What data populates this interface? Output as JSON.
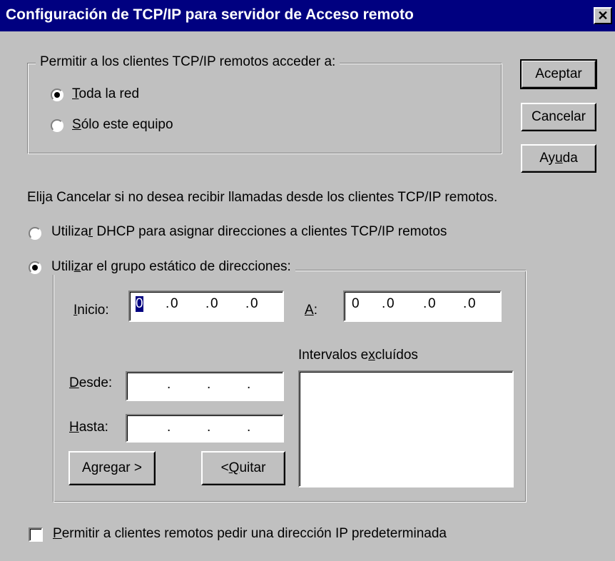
{
  "window": {
    "title": "Configuración de TCP/IP para servidor de Acceso remoto",
    "close_glyph": "✕"
  },
  "access_group": {
    "legend": "Permitir a los clientes TCP/IP remotos acceder a:",
    "options": [
      {
        "label_u": "T",
        "label_rest": "oda la red",
        "selected": true
      },
      {
        "label_u": "S",
        "label_rest": "ólo este equipo",
        "selected": false
      }
    ]
  },
  "buttons": {
    "accept": "Aceptar",
    "cancel": "Cancelar",
    "help_pre": "Ay",
    "help_u": "u",
    "help_post": "da"
  },
  "info_text": "Elija Cancelar si no desea recibir llamadas desde los clientes TCP/IP remotos.",
  "assignment": {
    "dhcp_pre": "Utiliza",
    "dhcp_u": "r",
    "dhcp_post": " DHCP para asignar direcciones a clientes TCP/IP remotos",
    "dhcp_selected": false,
    "static_pre": "Utili",
    "static_u": "z",
    "static_post": "ar el grupo estático de direcciones:",
    "static_selected": true
  },
  "static_pool": {
    "start_u": "I",
    "start_rest": "nicio:",
    "start_ip": [
      "0",
      "0",
      "0",
      "0"
    ],
    "end_u": "A",
    "end_rest": ":",
    "end_ip": [
      "0",
      "0",
      "0",
      "0"
    ],
    "excluded_pre": "Intervalos e",
    "excluded_u": "x",
    "excluded_post": "cluídos",
    "from_u": "D",
    "from_rest": "esde:",
    "to_u": "H",
    "to_rest": "asta:",
    "add_pre": "A",
    "add_u": "g",
    "add_post": "regar >",
    "remove_pre": "< ",
    "remove_u": "Q",
    "remove_post": "uitar"
  },
  "default_ip_checkbox": {
    "label_u": "P",
    "label_rest": "ermitir a clientes remotos pedir una dirección IP predeterminada",
    "checked": false
  }
}
